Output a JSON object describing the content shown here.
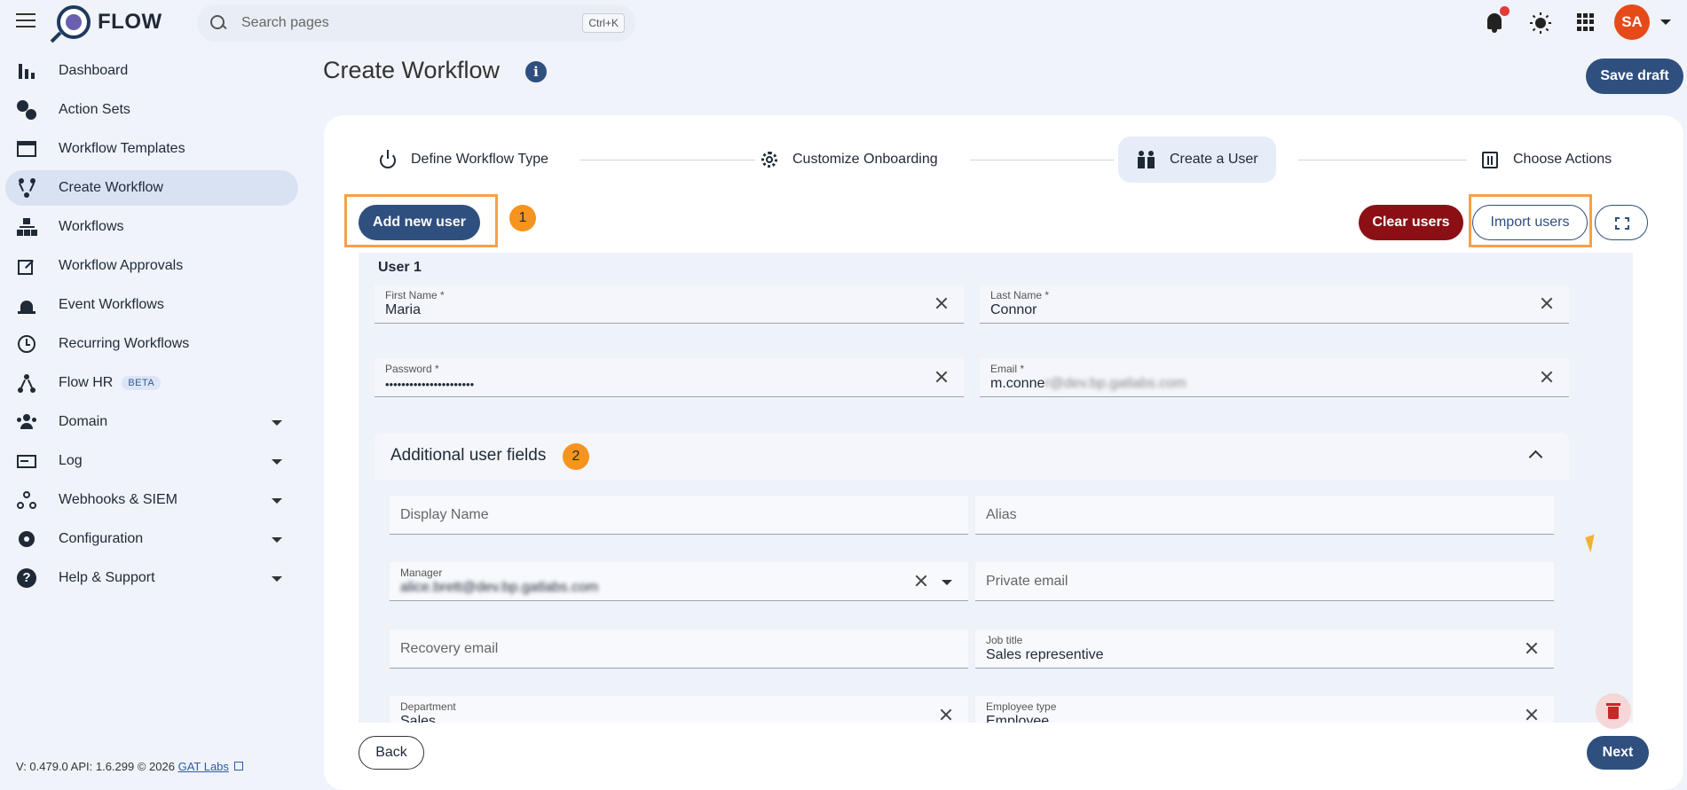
{
  "app": {
    "name": "FLOW"
  },
  "search": {
    "placeholder": "Search pages",
    "shortcut": "Ctrl+K"
  },
  "user": {
    "initials": "SA"
  },
  "colors": {
    "primary": "#2f4f7f",
    "danger": "#8b0f14",
    "highlight": "#f5a14b",
    "avatar": "#e64a19"
  },
  "sidebar": {
    "items": [
      {
        "label": "Dashboard",
        "icon": "bar-chart-icon"
      },
      {
        "label": "Action Sets",
        "icon": "gears-icon"
      },
      {
        "label": "Workflow Templates",
        "icon": "template-icon"
      },
      {
        "label": "Create Workflow",
        "icon": "fork-icon",
        "active": true
      },
      {
        "label": "Workflows",
        "icon": "hierarchy-icon"
      },
      {
        "label": "Workflow Approvals",
        "icon": "approval-check-icon"
      },
      {
        "label": "Event Workflows",
        "icon": "alarm-light-icon"
      },
      {
        "label": "Recurring Workflows",
        "icon": "clock-icon"
      },
      {
        "label": "Flow HR",
        "icon": "network-icon",
        "badge": "BETA"
      },
      {
        "label": "Domain",
        "icon": "people-icon",
        "expandable": true
      },
      {
        "label": "Log",
        "icon": "log-icon",
        "expandable": true
      },
      {
        "label": "Webhooks & SIEM",
        "icon": "webhook-icon",
        "expandable": true
      },
      {
        "label": "Configuration",
        "icon": "gear-icon",
        "expandable": true
      },
      {
        "label": "Help & Support",
        "icon": "help-icon",
        "expandable": true
      }
    ]
  },
  "footer": {
    "version": "V: 0.479.0  API: 1.6.299  © 2026",
    "link": "GAT Labs"
  },
  "header": {
    "title": "Create Workflow",
    "save_draft": "Save draft"
  },
  "steps": [
    {
      "label": "Define Workflow Type",
      "icon": "power-icon"
    },
    {
      "label": "Customize Onboarding",
      "icon": "gear-icon"
    },
    {
      "label": "Create a User",
      "icon": "users-icon",
      "active": true
    },
    {
      "label": "Choose Actions",
      "icon": "actions-icon"
    }
  ],
  "toolbar": {
    "add_user": "Add new user",
    "clear_users": "Clear users",
    "import_users": "Import users",
    "badge1": "1",
    "badge2": "2"
  },
  "form": {
    "user_title": "User 1",
    "first_name": {
      "label": "First Name *",
      "value": "Maria"
    },
    "last_name": {
      "label": "Last Name *",
      "value": "Connor"
    },
    "password": {
      "label": "Password *",
      "value": "••••••••••••••••••••••"
    },
    "email": {
      "label": "Email *",
      "value_visible": "m.conne",
      "value_blurred": "r@dev.bp.gatlabs.com"
    },
    "additional_title": "Additional user fields",
    "display_name": {
      "placeholder": "Display Name"
    },
    "alias": {
      "placeholder": "Alias"
    },
    "manager": {
      "label": "Manager",
      "value": "alice.brett@dev.bp.gatlabs.com"
    },
    "private_email": {
      "placeholder": "Private email"
    },
    "recovery_email": {
      "placeholder": "Recovery email"
    },
    "job_title": {
      "label": "Job title",
      "value": "Sales representive"
    },
    "department": {
      "label": "Department",
      "value": "Sales"
    },
    "employee_type": {
      "label": "Employee type",
      "value": "Employee"
    }
  },
  "nav": {
    "back": "Back",
    "next": "Next"
  }
}
